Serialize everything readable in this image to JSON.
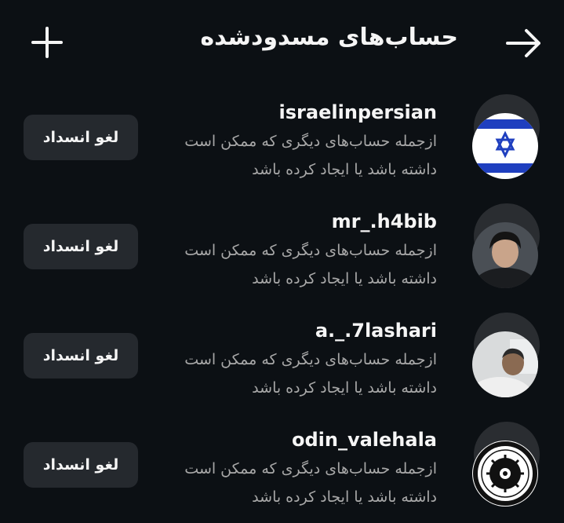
{
  "header": {
    "title": "حساب‌های مسدودشده",
    "add_icon": "plus-icon",
    "back_icon": "arrow-right-icon"
  },
  "blocked_accounts": [
    {
      "username": "israelinpersian",
      "description": "ازجمله حساب‌های دیگری که ممکن است داشته باشد یا ایجاد کرده باشد",
      "action_label": "لغو انسداد",
      "avatar": "israel-flag-avatar"
    },
    {
      "username": "mr_.h4bib",
      "description": "ازجمله حساب‌های دیگری که ممکن است داشته باشد یا ایجاد کرده باشد",
      "action_label": "لغو انسداد",
      "avatar": "profile-photo-avatar"
    },
    {
      "username": "a._.7lashari",
      "description": "ازجمله حساب‌های دیگری که ممکن است داشته باشد یا ایجاد کرده باشد",
      "action_label": "لغو انسداد",
      "avatar": "profile-photo-avatar"
    },
    {
      "username": "odin_valehala",
      "description": "ازجمله حساب‌های دیگری که ممکن است داشته باشد یا ایجاد کرده باشد",
      "action_label": "لغو انسداد",
      "avatar": "rune-emblem-avatar"
    }
  ],
  "colors": {
    "background": "#0c1014",
    "button": "#25292e",
    "secondary_text": "#a8a8a8",
    "flag_blue": "#1f3fbf"
  }
}
